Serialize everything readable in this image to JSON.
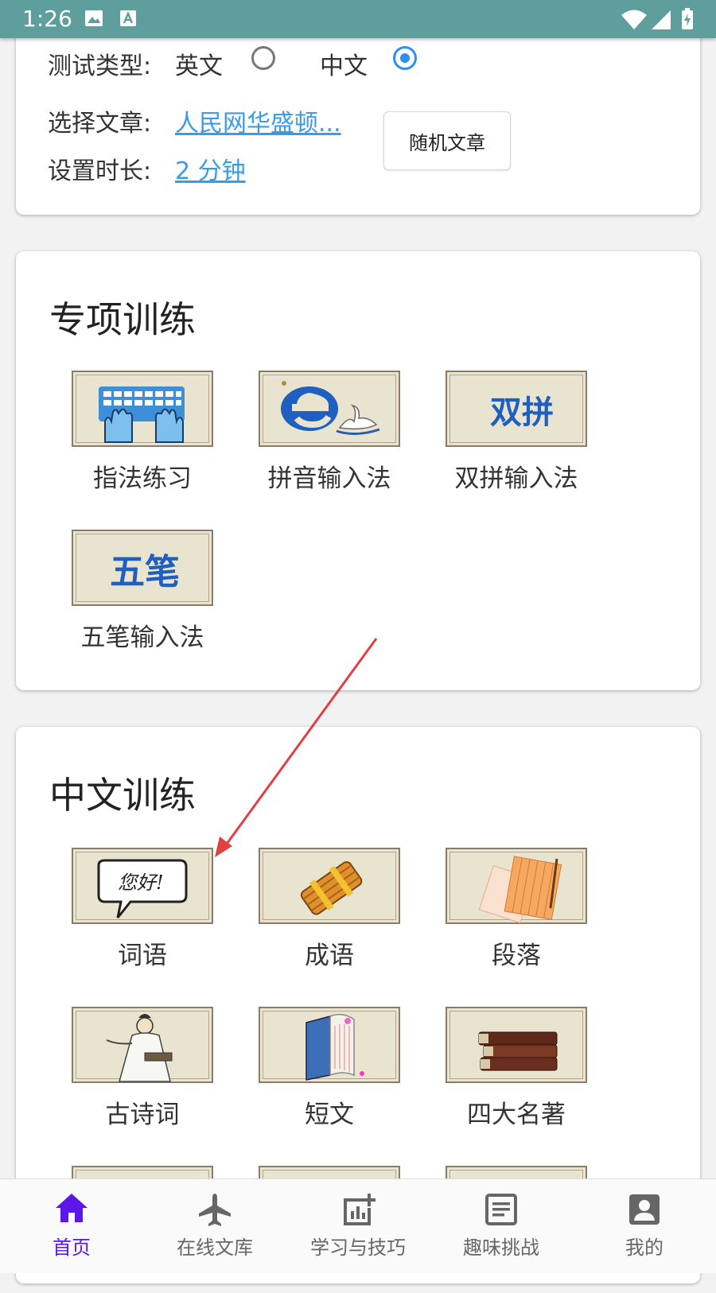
{
  "status_bar": {
    "time": "1:26"
  },
  "settings": {
    "test_type_label": "测试类型:",
    "option_english": "英文",
    "option_chinese": "中文",
    "selected": "中文",
    "article_label": "选择文章:",
    "article_value": "人民网华盛顿...",
    "duration_label": "设置时长:",
    "duration_value": "2 分钟",
    "random_button": "随机文章"
  },
  "special_training": {
    "title": "专项训练",
    "items": [
      {
        "label": "指法练习",
        "icon": "keyboard-hands-icon"
      },
      {
        "label": "拼音输入法",
        "icon": "pinyin-e-swan-icon"
      },
      {
        "label": "双拼输入法",
        "icon": "shuangpin-icon",
        "icon_text": "双拼"
      },
      {
        "label": "五笔输入法",
        "icon": "wubi-icon",
        "icon_text": "五笔"
      }
    ]
  },
  "chinese_training": {
    "title": "中文训练",
    "items": [
      {
        "label": "词语",
        "icon": "speech-bubble-icon",
        "icon_text": "您好!"
      },
      {
        "label": "成语",
        "icon": "bamboo-scroll-icon"
      },
      {
        "label": "段落",
        "icon": "paper-sheets-icon"
      },
      {
        "label": "古诗词",
        "icon": "scholar-icon"
      },
      {
        "label": "短文",
        "icon": "open-book-icon"
      },
      {
        "label": "四大名著",
        "icon": "stacked-books-icon"
      }
    ]
  },
  "bottom_nav": {
    "active": "首页",
    "items": [
      {
        "label": "首页",
        "icon": "home-icon"
      },
      {
        "label": "在线文库",
        "icon": "airplane-icon"
      },
      {
        "label": "学习与技巧",
        "icon": "chart-plus-icon"
      },
      {
        "label": "趣味挑战",
        "icon": "document-icon"
      },
      {
        "label": "我的",
        "icon": "profile-icon"
      }
    ]
  },
  "colors": {
    "status_bar": "#5e9e9c",
    "link": "#3b9be6",
    "radio_selected": "#2f8ff0",
    "nav_active": "#5b17e6",
    "annotation_arrow": "#e04040"
  }
}
